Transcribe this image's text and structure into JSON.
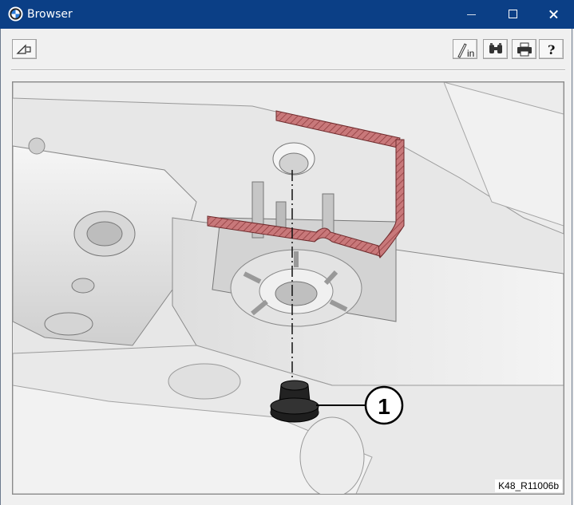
{
  "window": {
    "title": "Browser",
    "app_icon": "bmw-logo-icon"
  },
  "window_controls": [
    "minimize-icon",
    "maximize-icon",
    "close-icon"
  ],
  "toolbar": {
    "left": [
      {
        "icon": "back-triangle-icon"
      }
    ],
    "right": [
      {
        "icon": "zoom-in-pen-icon",
        "label": "in"
      },
      {
        "icon": "binoculars-icon"
      },
      {
        "icon": "printer-icon"
      },
      {
        "icon": "help-question-icon",
        "label": "?"
      }
    ]
  },
  "figure": {
    "callouts": [
      {
        "number": "1"
      }
    ],
    "caption": "K48_R11006b"
  },
  "colors": {
    "titlebar": "#0b3f86",
    "section_hatch": "#b85a5a"
  }
}
